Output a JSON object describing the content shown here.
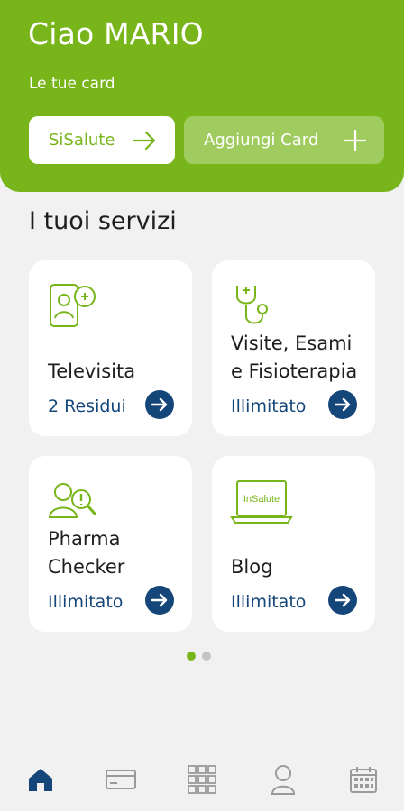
{
  "header": {
    "greeting": "Ciao MARIO",
    "cards_label": "Le tue card",
    "primary_card": {
      "label": "SiSalute",
      "icon": "arrow-right-icon"
    },
    "add_card": {
      "label": "Aggiungi Card",
      "icon": "plus-icon"
    }
  },
  "services": {
    "title": "I tuoi servizi",
    "tiles": [
      {
        "name": "Televisita",
        "status": "2 Residui",
        "icon": "video-call-icon"
      },
      {
        "name": "Visite, Esami e Fisioterapia",
        "status": "Illimitato",
        "icon": "stethoscope-icon"
      },
      {
        "name": "Pharma Checker",
        "status": "Illimitato",
        "icon": "pharma-search-icon"
      },
      {
        "name": "Blog",
        "status": "Illimitato",
        "icon": "laptop-icon",
        "screen_text": "InSalute"
      }
    ]
  },
  "pagination": {
    "pages": 2,
    "current": 1
  },
  "bottom_nav": {
    "items": [
      {
        "icon": "home-icon",
        "active": true
      },
      {
        "icon": "card-icon",
        "active": false
      },
      {
        "icon": "grid-icon",
        "active": false
      },
      {
        "icon": "profile-icon",
        "active": false
      },
      {
        "icon": "calendar-icon",
        "active": false
      }
    ]
  },
  "colors": {
    "brand_green": "#78b51a",
    "navy": "#15467a",
    "background": "#f1f1f1",
    "nav_inactive": "#9a9a9a"
  }
}
